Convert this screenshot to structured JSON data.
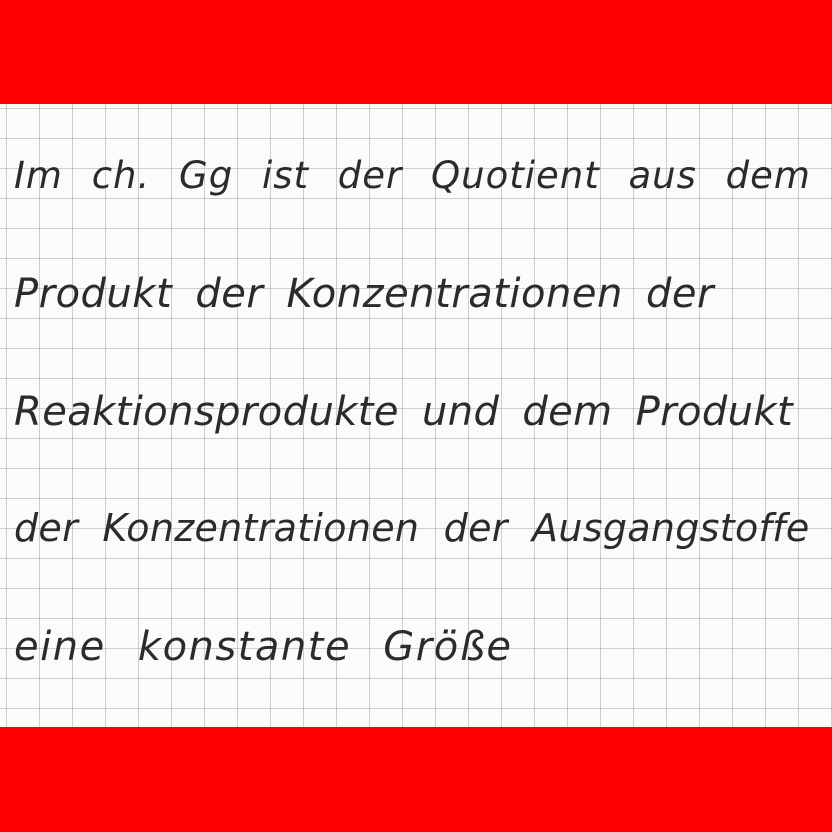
{
  "colors": {
    "band": "#ff0000",
    "paper": "#fbfbfb",
    "grid": "#969696",
    "ink": "#2b2b2b"
  },
  "handwriting": {
    "lines": [
      "Im ch. Gg ist der Quotient aus dem",
      "Produkt der Konzentrationen der",
      "Reaktionsprodukte und dem Produkt",
      "der Konzentrationen der Ausgangstoffe",
      "eine konstante Größe"
    ]
  }
}
